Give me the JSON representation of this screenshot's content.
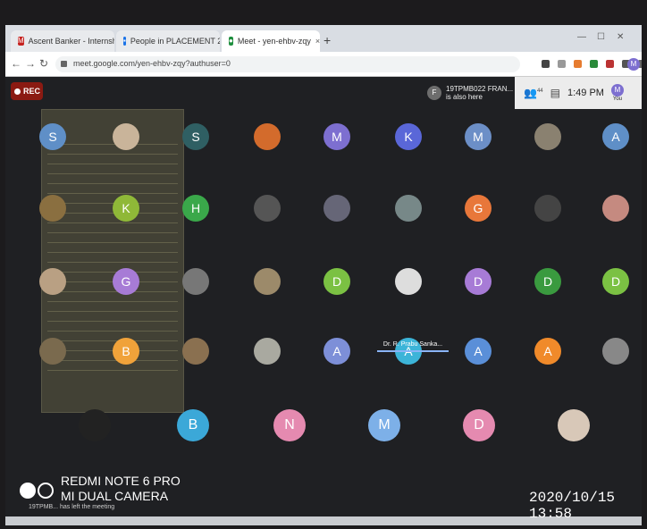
{
  "browser": {
    "tabs": [
      {
        "label": "Ascent Banker - Internship Progr",
        "icon": "gmail-icon",
        "color": "#c5221f"
      },
      {
        "label": "People in PLACEMENT 2019-202",
        "icon": "classroom-icon",
        "color": "#1a73e8"
      },
      {
        "label": "Meet - yen-ehbv-zqy",
        "icon": "meet-icon",
        "color": "#1e8e3e"
      }
    ],
    "url": "meet.google.com/yen-ehbv-zqy?authuser=0",
    "profile_initial": "M"
  },
  "meet": {
    "rec_label": "REC",
    "notice": {
      "initial": "F",
      "text": "19TPMB022 FRAN... is also here"
    },
    "participant_count": "44",
    "time": "1:49 PM",
    "you_label": "You",
    "self_initial": "M",
    "speaker_label": "Dr. R. Prabu Sanka...",
    "left_message": "19TPMB... has left the meeting",
    "tiles": [
      {
        "label": "S",
        "color": "#5f8fc7"
      },
      {
        "label": "",
        "color": "#c9b49a"
      },
      {
        "label": "S",
        "color": "#2f5f63"
      },
      {
        "label": "",
        "color": "#d36b2c"
      },
      {
        "label": "M",
        "color": "#7d6fd0"
      },
      {
        "label": "K",
        "color": "#5a67d8"
      },
      {
        "label": "M",
        "color": "#6c8fc7"
      },
      {
        "label": "",
        "color": "#8a8170"
      },
      {
        "label": "A",
        "color": "#5f8fc7"
      },
      {
        "label": "",
        "color": "#8a6f40"
      },
      {
        "label": "K",
        "color": "#8fb838"
      },
      {
        "label": "H",
        "color": "#3aa84a"
      },
      {
        "label": "",
        "color": "#555"
      },
      {
        "label": "",
        "color": "#667"
      },
      {
        "label": "",
        "color": "#788"
      },
      {
        "label": "G",
        "color": "#e8773a"
      },
      {
        "label": "",
        "color": "#444"
      },
      {
        "label": "",
        "color": "#c58a80"
      },
      {
        "label": "",
        "color": "#b9a083"
      },
      {
        "label": "G",
        "color": "#a77bd6"
      },
      {
        "label": "",
        "color": "#777"
      },
      {
        "label": "",
        "color": "#9c8a6a"
      },
      {
        "label": "D",
        "color": "#7bc143"
      },
      {
        "label": "",
        "color": "#ddd"
      },
      {
        "label": "D",
        "color": "#a77bd6"
      },
      {
        "label": "D",
        "color": "#3a9a3f"
      },
      {
        "label": "D",
        "color": "#7bc143"
      },
      {
        "label": "",
        "color": "#7a6a4e"
      },
      {
        "label": "B",
        "color": "#f0a23a"
      },
      {
        "label": "",
        "color": "#8a7050"
      },
      {
        "label": "",
        "color": "#a9a9a0"
      },
      {
        "label": "A",
        "color": "#7d8fd8"
      },
      {
        "label": "A",
        "color": "#3cb4d8"
      },
      {
        "label": "A",
        "color": "#5a8fd8"
      },
      {
        "label": "A",
        "color": "#f08a2a"
      },
      {
        "label": "",
        "color": "#888"
      },
      {
        "label": "",
        "color": "#222"
      },
      {
        "label": "B",
        "color": "#3ba8d8"
      },
      {
        "label": "N",
        "color": "#e58ab0"
      },
      {
        "label": "M",
        "color": "#7db0e8"
      },
      {
        "label": "D",
        "color": "#e58ab0"
      },
      {
        "label": "",
        "color": "#d8c8b8"
      }
    ]
  },
  "watermark": {
    "line1": "REDMI NOTE 6 PRO",
    "line2": "MI DUAL CAMERA",
    "date": "2020/10/15  13:58"
  }
}
